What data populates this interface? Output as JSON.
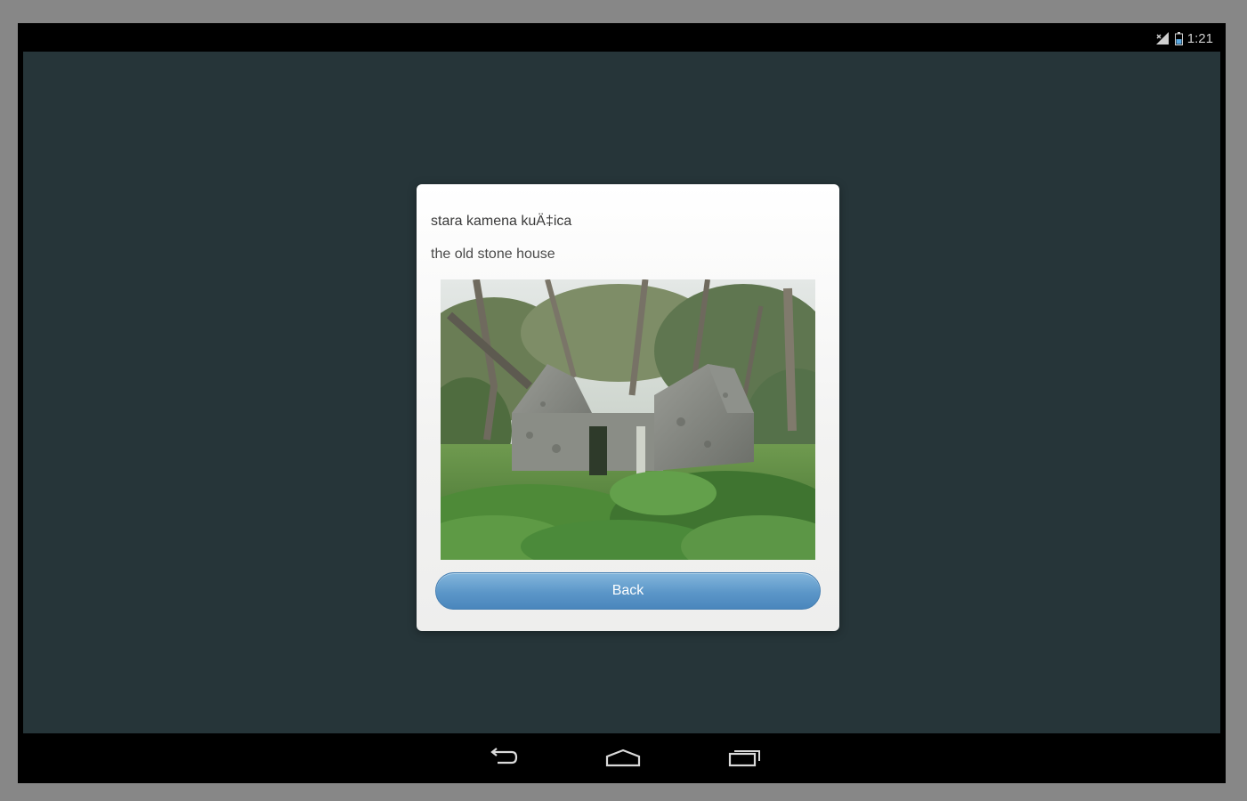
{
  "status_bar": {
    "time": "1:21",
    "icons": [
      "signal-icon",
      "battery-icon"
    ]
  },
  "dialog": {
    "title": "stara kamena kuÄ‡ica",
    "subtitle": "the old stone house",
    "image": {
      "subject": "ruined-stone-house-photo"
    },
    "back_label": "Back"
  },
  "nav_bar": {
    "buttons": [
      "back-icon",
      "home-icon",
      "recent-apps-icon"
    ]
  },
  "colors": {
    "app_background": "#263539",
    "button_accent": "#5b96c8",
    "dialog_background": "#f5f5f4"
  }
}
